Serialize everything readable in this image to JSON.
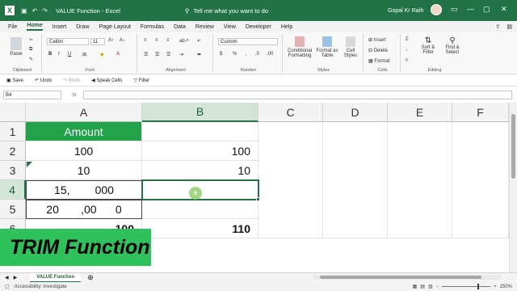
{
  "titlebar": {
    "app_icon": "X",
    "title": "VALUE Function  -  Excel",
    "search": "Tell me what you want to do",
    "user": "Gopal Kr Rath"
  },
  "tabs": [
    "File",
    "Home",
    "Insert",
    "Draw",
    "Page Layout",
    "Formulas",
    "Data",
    "Review",
    "View",
    "Developer",
    "Help"
  ],
  "ribbon": {
    "paste": "Paste",
    "clipboard": "Clipboard",
    "font_name": "Calibri",
    "font_size": "11",
    "font_group": "Font",
    "alignment": "Alignment",
    "number_format": "Custom",
    "number_group": "Number",
    "conditional": "Conditional Formatting",
    "format_table": "Format as Table",
    "cell_styles": "Cell Styles",
    "styles_group": "Styles",
    "insert": "Insert",
    "delete": "Delete",
    "format": "Format",
    "cells_group": "Cells",
    "sort": "Sort & Filter",
    "find": "Find & Select",
    "editing_group": "Editing"
  },
  "qat": {
    "save": "Save",
    "undo": "Undo",
    "redo": "Redo",
    "speak": "Speak Cells",
    "filter": "Filter"
  },
  "formula": {
    "namebox": "B4",
    "fx": "fx",
    "value": ""
  },
  "columns": [
    "A",
    "B",
    "C",
    "D",
    "E",
    "F"
  ],
  "rows": [
    "1",
    "2",
    "3",
    "4",
    "5",
    "6"
  ],
  "cells": {
    "A1": "Amount",
    "A2": "100",
    "A3": "10",
    "A4": "15,        000",
    "A5": "20       ,00      0",
    "A6": "100",
    "B2": "100",
    "B3": "10",
    "B6": "110"
  },
  "overlay": {
    "text": "TRIM Function"
  },
  "sheet": {
    "tab": "VALUE Function"
  },
  "status": {
    "accessibility": "Accessibility: Investigate",
    "zoom": "250%"
  },
  "colors": {
    "excel_green": "#217346",
    "header_fill": "#22a34a",
    "overlay": "#2fc25c"
  }
}
